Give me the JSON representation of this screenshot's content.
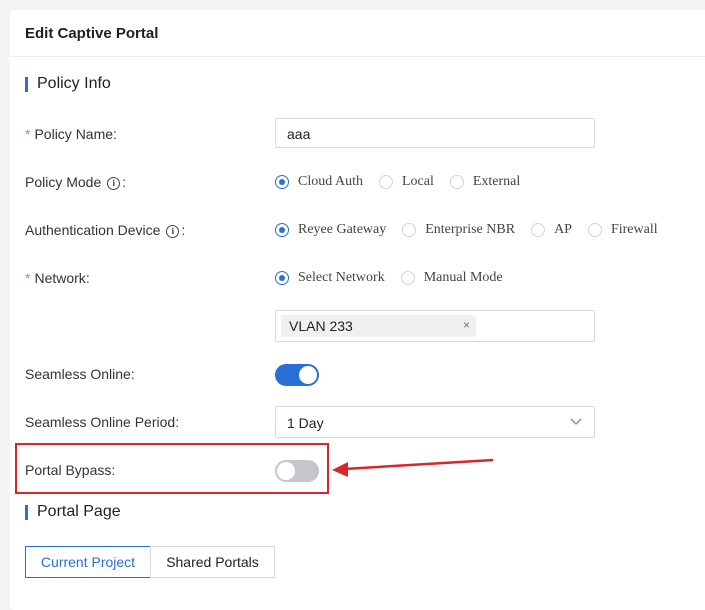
{
  "header": {
    "title": "Edit Captive Portal"
  },
  "sections": {
    "policy_info": "Policy Info",
    "portal_page": "Portal Page"
  },
  "fields": {
    "policy_name": {
      "required": "*",
      "label": "Policy Name",
      "colon": ":",
      "value": "aaa"
    },
    "policy_mode": {
      "label": "Policy Mode",
      "colon": ":",
      "options": [
        "Cloud Auth",
        "Local",
        "External"
      ],
      "selected": "Cloud Auth"
    },
    "auth_device": {
      "label": "Authentication Device",
      "colon": ":",
      "options": [
        "Reyee Gateway",
        "Enterprise NBR",
        "AP",
        "Firewall"
      ],
      "selected": "Reyee Gateway"
    },
    "network": {
      "required": "*",
      "label": "Network",
      "colon": ":",
      "options": [
        "Select Network",
        "Manual Mode"
      ],
      "selected": "Select Network",
      "tag": "VLAN 233",
      "tag_remove": "×"
    },
    "seamless_online": {
      "label": "Seamless Online",
      "colon": ":",
      "enabled": true
    },
    "seamless_period": {
      "label": "Seamless Online Period",
      "colon": ":",
      "value": "1 Day"
    },
    "portal_bypass": {
      "label": "Portal Bypass",
      "colon": ":",
      "enabled": false
    }
  },
  "portal_tabs": [
    "Current Project",
    "Shared Portals"
  ],
  "portal_tab_active": "Current Project",
  "annotation_color": "#d9262a",
  "accent_color": "#2a6fd6",
  "icons": [
    "info-icon",
    "chevron-down-icon",
    "close-icon"
  ]
}
